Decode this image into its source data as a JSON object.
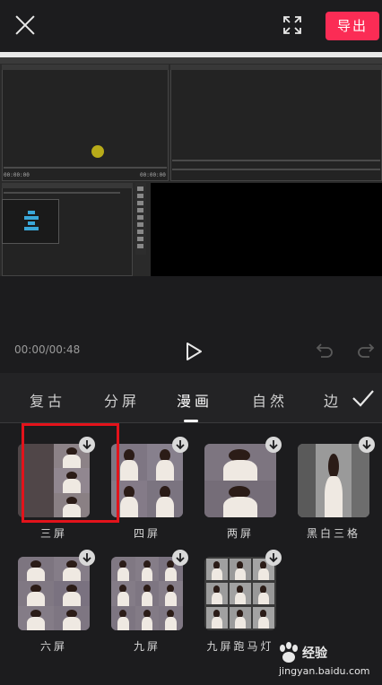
{
  "header": {
    "export_label": "导出"
  },
  "preview": {
    "left_time": "00:00:00",
    "right_time": "00:00:00"
  },
  "playback": {
    "timecode": "00:00/00:48"
  },
  "tabs": [
    {
      "label": "复古",
      "active": false
    },
    {
      "label": "分屏",
      "active": false
    },
    {
      "label": "漫画",
      "active": true
    },
    {
      "label": "自然",
      "active": false
    },
    {
      "label": "边",
      "active": false
    }
  ],
  "effects": [
    {
      "label": "三屏",
      "selected": true,
      "layout": "three-screen"
    },
    {
      "label": "四屏",
      "selected": false,
      "layout": "four-screen"
    },
    {
      "label": "两屏",
      "selected": false,
      "layout": "two-screen"
    },
    {
      "label": "黑白三格",
      "selected": false,
      "layout": "bw-three"
    },
    {
      "label": "六屏",
      "selected": false,
      "layout": "six-screen"
    },
    {
      "label": "九屏",
      "selected": false,
      "layout": "nine-screen"
    },
    {
      "label": "九屏跑马灯",
      "selected": false,
      "layout": "nine-marquee"
    }
  ],
  "watermark": {
    "brand": "经验",
    "url": "jingyan.baidu.com"
  },
  "colors": {
    "accent": "#fb2c55",
    "selection": "#e3131b",
    "background": "#1c1c1e"
  }
}
